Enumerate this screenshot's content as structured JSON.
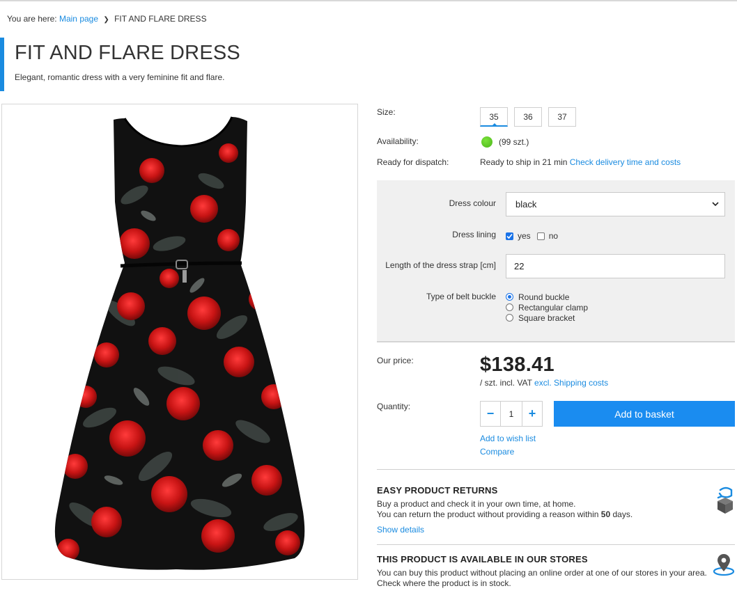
{
  "breadcrumb": {
    "prefix": "You are here:",
    "home": "Main page",
    "current": "FIT AND FLARE DRESS"
  },
  "product": {
    "title": "FIT AND FLARE DRESS",
    "subtitle": "Elegant, romantic dress with a very feminine fit and flare."
  },
  "info": {
    "size_label": "Size:",
    "sizes": [
      "35",
      "36",
      "37"
    ],
    "selected_size": "35",
    "availability_label": "Availability:",
    "availability_value": "(99 szt.)",
    "dispatch_label": "Ready for dispatch:",
    "dispatch_value": "Ready to ship in 21 min",
    "dispatch_link": "Check delivery time and costs"
  },
  "options": {
    "colour_label": "Dress colour",
    "colour_value": "black",
    "lining_label": "Dress lining",
    "lining_yes": "yes",
    "lining_no": "no",
    "lining_yes_checked": true,
    "lining_no_checked": false,
    "strap_label": "Length of the dress strap [cm]",
    "strap_value": "22",
    "buckle_label": "Type of belt buckle",
    "buckle_options": [
      "Round buckle",
      "Rectangular clamp",
      "Square bracket"
    ],
    "buckle_selected": "Round buckle"
  },
  "pricing": {
    "label": "Our price:",
    "value": "$138.41",
    "note": "/ szt. incl. VAT",
    "excl_link": "excl. Shipping costs"
  },
  "purchase": {
    "quantity_label": "Quantity:",
    "quantity_value": "1",
    "minus": "−",
    "plus": "+",
    "add_button": "Add to basket",
    "wishlist_link": "Add to wish list",
    "compare_link": "Compare"
  },
  "returns": {
    "title": "EASY PRODUCT RETURNS",
    "line1": "Buy a product and check it in your own time, at home.",
    "line2_pre": "You can return the product without providing a reason within",
    "line2_days": "50",
    "line2_post": "days.",
    "details_link": "Show details",
    "icon": "return-box-icon"
  },
  "stores": {
    "title": "THIS PRODUCT IS AVAILABLE IN OUR STORES",
    "line1": "You can buy this product without placing an online order at one of our stores in your area.",
    "line2": "Check where the product is in stock.",
    "icon": "map-pin-icon"
  },
  "colors": {
    "accent": "#1a8be0",
    "button": "#1a8cf0",
    "stock_dot": "#5cc421",
    "panel_bg": "#f0f0f0"
  }
}
